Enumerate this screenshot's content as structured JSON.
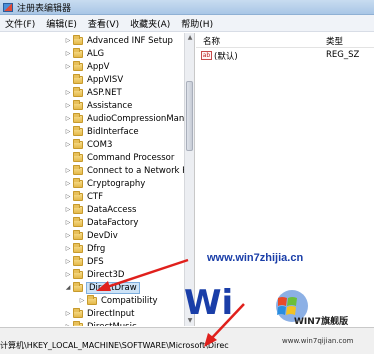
{
  "window": {
    "title": "注册表编辑器"
  },
  "menu": [
    "文件(F)",
    "编辑(E)",
    "查看(V)",
    "收藏夹(A)",
    "帮助(H)"
  ],
  "tree": {
    "nodes": [
      {
        "label": "Advanced INF Setup",
        "indent": 1,
        "expand": "collapsed"
      },
      {
        "label": "ALG",
        "indent": 1,
        "expand": "collapsed"
      },
      {
        "label": "AppV",
        "indent": 1,
        "expand": "collapsed"
      },
      {
        "label": "AppVISV",
        "indent": 1,
        "expand": "none"
      },
      {
        "label": "ASP.NET",
        "indent": 1,
        "expand": "collapsed"
      },
      {
        "label": "Assistance",
        "indent": 1,
        "expand": "collapsed"
      },
      {
        "label": "AudioCompressionManag",
        "indent": 1,
        "expand": "collapsed"
      },
      {
        "label": "BidInterface",
        "indent": 1,
        "expand": "collapsed"
      },
      {
        "label": "COM3",
        "indent": 1,
        "expand": "collapsed"
      },
      {
        "label": "Command Processor",
        "indent": 1,
        "expand": "none"
      },
      {
        "label": "Connect to a Network Pro",
        "indent": 1,
        "expand": "collapsed"
      },
      {
        "label": "Cryptography",
        "indent": 1,
        "expand": "collapsed"
      },
      {
        "label": "CTF",
        "indent": 1,
        "expand": "collapsed"
      },
      {
        "label": "DataAccess",
        "indent": 1,
        "expand": "collapsed"
      },
      {
        "label": "DataFactory",
        "indent": 1,
        "expand": "collapsed"
      },
      {
        "label": "DevDiv",
        "indent": 1,
        "expand": "collapsed"
      },
      {
        "label": "Dfrg",
        "indent": 1,
        "expand": "collapsed"
      },
      {
        "label": "DFS",
        "indent": 1,
        "expand": "collapsed"
      },
      {
        "label": "Direct3D",
        "indent": 1,
        "expand": "collapsed"
      },
      {
        "label": "DirectDraw",
        "indent": 1,
        "expand": "expanded",
        "selected": true
      },
      {
        "label": "Compatibility",
        "indent": 2,
        "expand": "collapsed"
      },
      {
        "label": "DirectInput",
        "indent": 1,
        "expand": "collapsed"
      },
      {
        "label": "DirectMusic",
        "indent": 1,
        "expand": "collapsed"
      }
    ]
  },
  "list": {
    "headers": {
      "name": "名称",
      "type": "类型"
    },
    "rows": [
      {
        "icon": "ab",
        "name": "(默认)",
        "type": "REG_SZ"
      }
    ]
  },
  "statusbar": {
    "path": "计算机\\HKEY_LOCAL_MACHINE\\SOFTWARE\\Microsoft\\Direc"
  },
  "watermark": {
    "url": "www.win7zhijia.cn",
    "brand": "WIN7旗舰版",
    "sub": "www.win7qijian.com"
  },
  "colors": {
    "title_bar": "#b8d2ee",
    "selection": "#cde3f7",
    "arrow": "#e0201c",
    "watermark_blue": "#1a3ea8"
  }
}
